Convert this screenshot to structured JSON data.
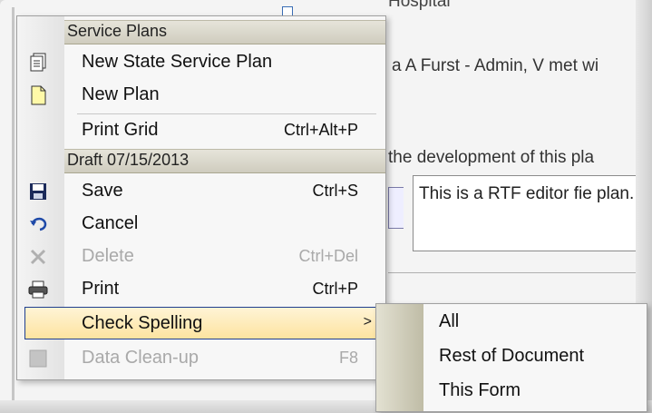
{
  "background": {
    "top_text": "Hospital",
    "line1": "a A Furst - Admin, V met wi",
    "line2": "the development of this pla",
    "rtf_text": "This is a RTF editor fie plan."
  },
  "menu": {
    "section1": "Service Plans",
    "items1": [
      {
        "label": "New State Service Plan",
        "shortcut": "",
        "icon": "document-stack-icon"
      },
      {
        "label": "New Plan",
        "shortcut": "",
        "icon": "new-document-icon"
      },
      {
        "label": "Print Grid",
        "shortcut": "Ctrl+Alt+P",
        "icon": ""
      }
    ],
    "section2": "Draft 07/15/2013",
    "items2": [
      {
        "label": "Save",
        "shortcut": "Ctrl+S",
        "icon": "floppy-disk-icon",
        "disabled": false
      },
      {
        "label": "Cancel",
        "shortcut": "",
        "icon": "undo-arrow-icon",
        "disabled": false
      },
      {
        "label": "Delete",
        "shortcut": "Ctrl+Del",
        "icon": "delete-x-icon",
        "disabled": true
      },
      {
        "label": "Print",
        "shortcut": "Ctrl+P",
        "icon": "printer-icon",
        "disabled": false
      },
      {
        "label": "Check Spelling",
        "shortcut": ">",
        "icon": "",
        "disabled": false
      },
      {
        "label": "Data Clean-up",
        "shortcut": "F8",
        "icon": "data-cleanup-icon",
        "disabled": true
      }
    ]
  },
  "submenu": {
    "items": [
      "All",
      "Rest of Document",
      "This Form"
    ]
  },
  "colors": {
    "highlight": "#fde3a0",
    "highlight_border": "#1f3f8f",
    "disabled_text": "#a9a9a9"
  }
}
